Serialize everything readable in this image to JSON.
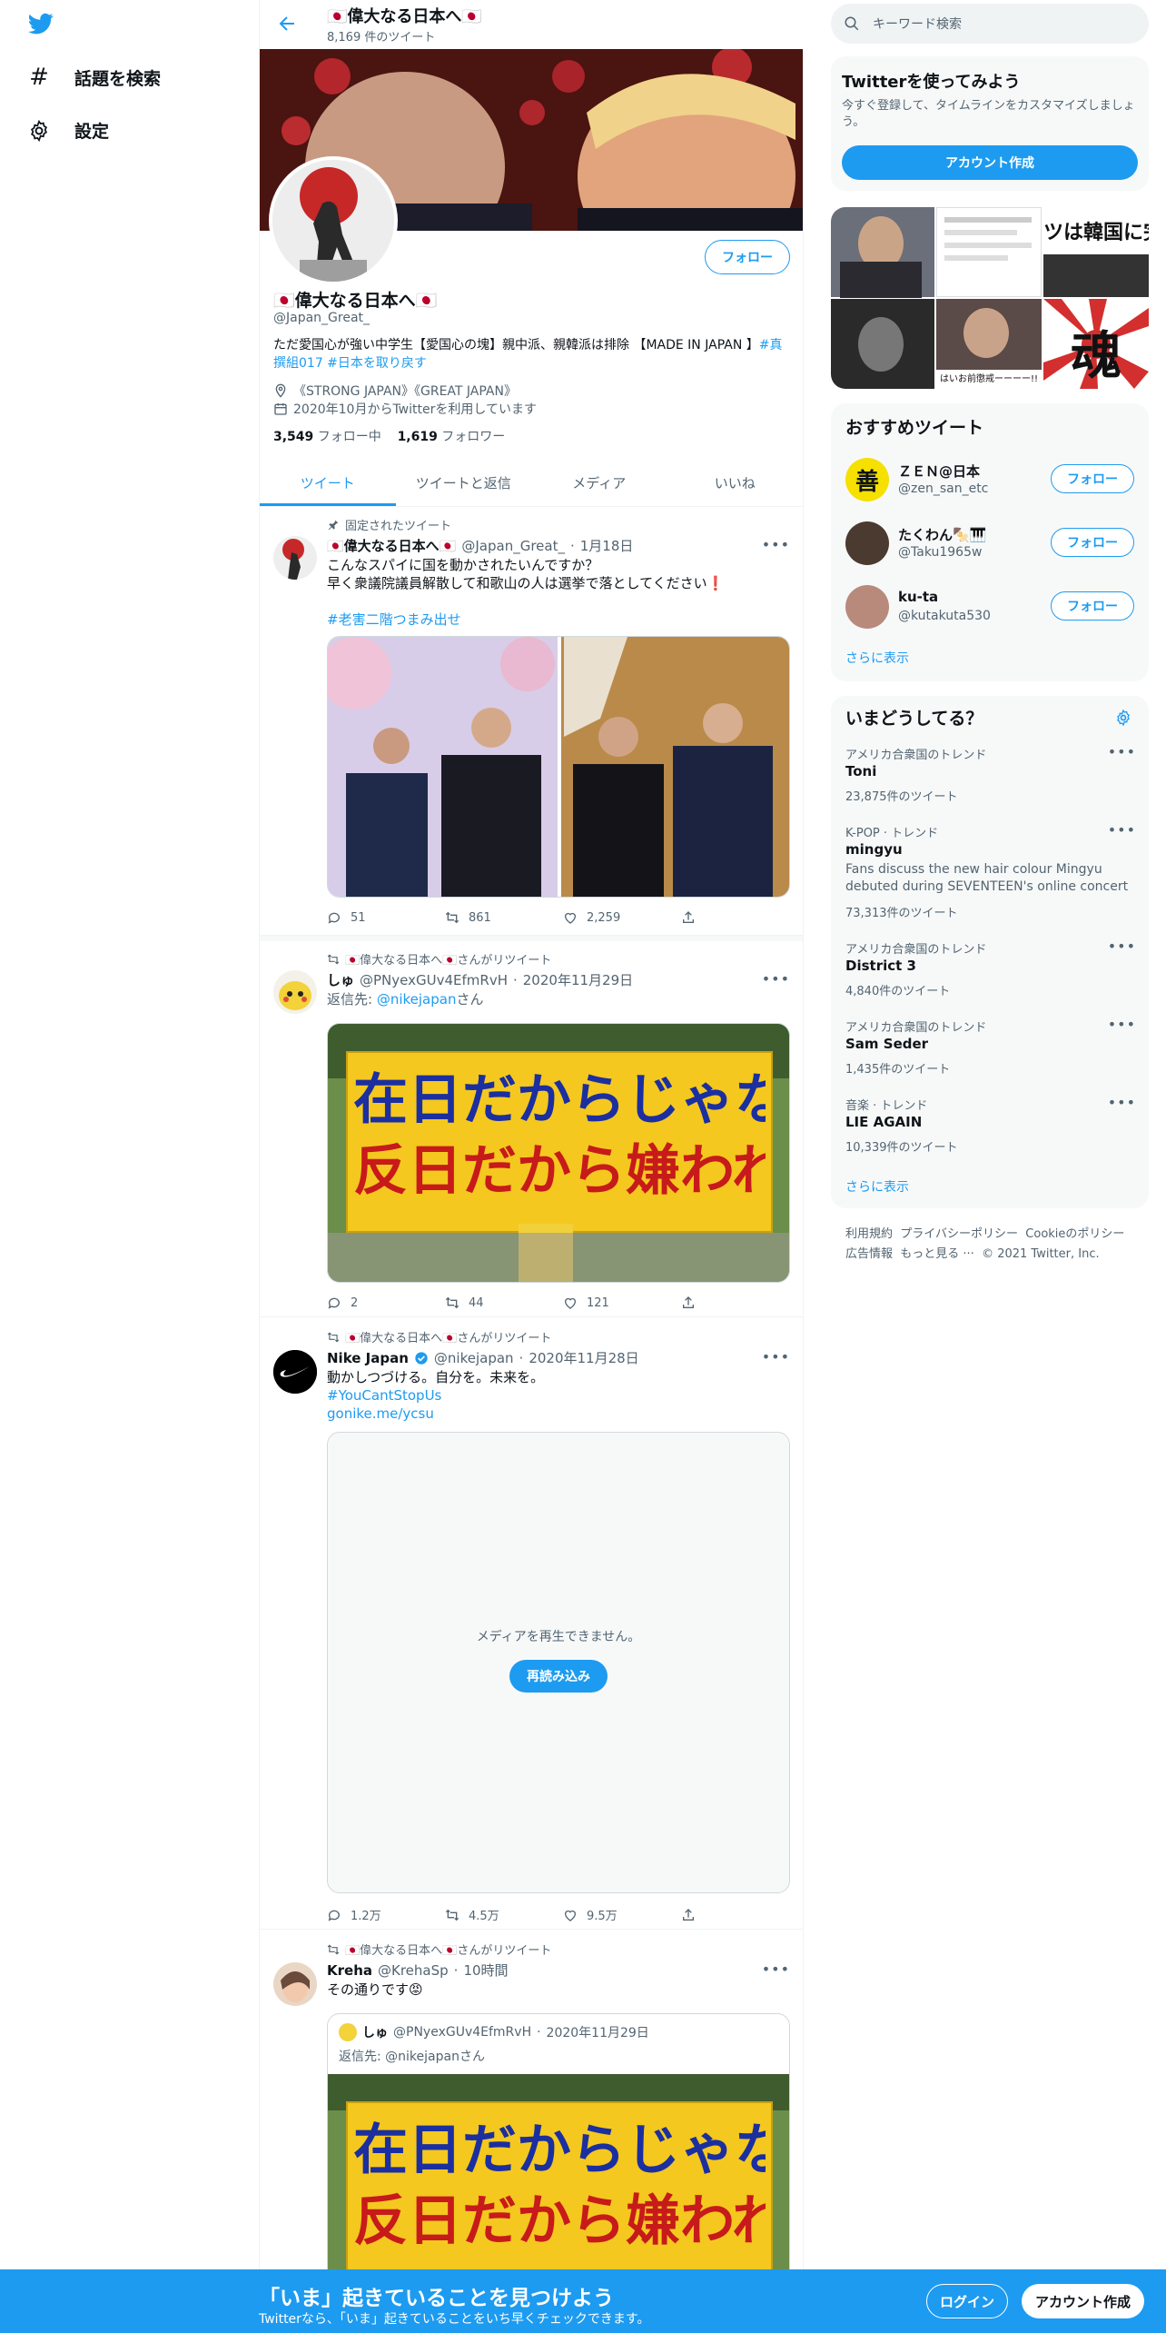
{
  "nav": {
    "explore": "話題を検索",
    "settings": "設定"
  },
  "profile": {
    "title": "🇯🇵偉大なる日本へ🇯🇵",
    "tweet_count": "8,169 件のツイート",
    "name": "🇯🇵偉大なる日本へ🇯🇵",
    "handle": "@Japan_Great_",
    "follow": "フォロー",
    "bio_text": "ただ愛国心が強い中学生【愛国心の塊】親中派、親韓派は排除 【MADE IN JAPAN 】",
    "bio_tags": "#真撰組017 #日本を取り戻す",
    "location": "《STRONG JAPAN》《GREAT JAPAN》",
    "joined": "2020年10月からTwitterを利用しています",
    "following_num": "3,549",
    "following_label": " フォロー中",
    "followers_num": "1,619",
    "followers_label": " フォロワー"
  },
  "tabs": [
    "ツイート",
    "ツイートと返信",
    "メディア",
    "いいね"
  ],
  "tweets": [
    {
      "context": "固定されたツイート",
      "name": "🇯🇵偉大なる日本へ🇯🇵",
      "handle": "@Japan_Great_",
      "date": "1月18日",
      "line1": "こんなスパイに国を動かされたいんですか？",
      "line2": "早く衆議院議員解散して和歌山の人は選挙で落としてください❗",
      "hashtag": "#老害二階つまみ出せ",
      "replies": "51",
      "retweets": "861",
      "likes": "2,259"
    },
    {
      "context": "🇯🇵偉大なる日本へ🇯🇵さんがリツイート",
      "name": "しゅ",
      "handle": "@PNyexGUv4EfmRvH",
      "date": "2020年11月29日",
      "reply_to_label": "返信先: ",
      "reply_to": "@nikejapan",
      "reply_to_suffix": "さん",
      "sign_line1": "在日だからじゃない",
      "sign_line2": "反日だから嫌われる",
      "replies": "2",
      "retweets": "44",
      "likes": "121"
    },
    {
      "context": "🇯🇵偉大なる日本へ🇯🇵さんがリツイート",
      "name": "Nike Japan",
      "handle": "@nikejapan",
      "date": "2020年11月28日",
      "line1": "動かしつづける。自分を。未来を。",
      "hashtag": "#YouCantStopUs",
      "url": "gonike.me/ycsu",
      "media_error": "メディアを再生できません。",
      "reload": "再読み込み",
      "replies": "1.2万",
      "retweets": "4.5万",
      "likes": "9.5万"
    },
    {
      "context": "🇯🇵偉大なる日本へ🇯🇵さんがリツイート",
      "name": "Kreha",
      "handle": "@KrehaSp",
      "date": "10時間",
      "line1": "その通りです😡",
      "quote_name": "しゅ",
      "quote_handle": "@PNyexGUv4EfmRvH",
      "quote_date": "2020年11月29日",
      "quote_reply": "返信先: @nikejapanさん",
      "sign_line1": "在日だからじゃない",
      "sign_line2": "反日だから嫌われる"
    }
  ],
  "right": {
    "search_placeholder": "キーワード検索",
    "signup_title": "Twitterを使ってみよう",
    "signup_text": "今すぐ登録して、タイムラインをカスタマイズしましょう。",
    "signup_button": "アカウント作成",
    "media_texts": [
      "ツは韓国に完",
      "はいお前懲戒ーーーー!!",
      "魂"
    ],
    "recommend_title": "おすすめツイート",
    "recommend": [
      {
        "name": "ＺＥＮ@日本",
        "handle": "@zen_san_etc",
        "avatar_text": "善"
      },
      {
        "name": "たくわん🍢🎹",
        "handle": "@Taku1965w"
      },
      {
        "name": "ku-ta",
        "handle": "@kutakuta530"
      }
    ],
    "follow": "フォロー",
    "show_more": "さらに表示",
    "trends_title": "いまどうしてる？",
    "trends": [
      {
        "label": "アメリカ合衆国のトレンド",
        "title": "Toni",
        "count": "23,875件のツイート"
      },
      {
        "label": "K-POP · トレンド",
        "title": "mingyu",
        "desc": "Fans discuss the new hair colour Mingyu debuted during SEVENTEEN's online concert",
        "count": "73,313件のツイート"
      },
      {
        "label": "アメリカ合衆国のトレンド",
        "title": "District 3",
        "count": "4,840件のツイート"
      },
      {
        "label": "アメリカ合衆国のトレンド",
        "title": "Sam Seder",
        "count": "1,435件のツイート"
      },
      {
        "label": "音楽 · トレンド",
        "title": "LIE AGAIN",
        "count": "10,339件のツイート"
      }
    ],
    "footer_line1": [
      "利用規約",
      "プライバシーポリシー",
      "Cookieのポリシー"
    ],
    "footer_line2": [
      "広告情報",
      "もっと見る ···",
      "© 2021 Twitter, Inc."
    ]
  },
  "bottom": {
    "title": "「いま」起きていることを見つけよう",
    "subtitle": "Twitterなら、「いま」起きていることをいち早くチェックできます。",
    "login": "ログイン",
    "signup": "アカウント作成"
  },
  "colors": {
    "accent": "#1d9bf0",
    "text": "#0f1419",
    "muted": "#536471",
    "panel": "#f7f9f9"
  }
}
